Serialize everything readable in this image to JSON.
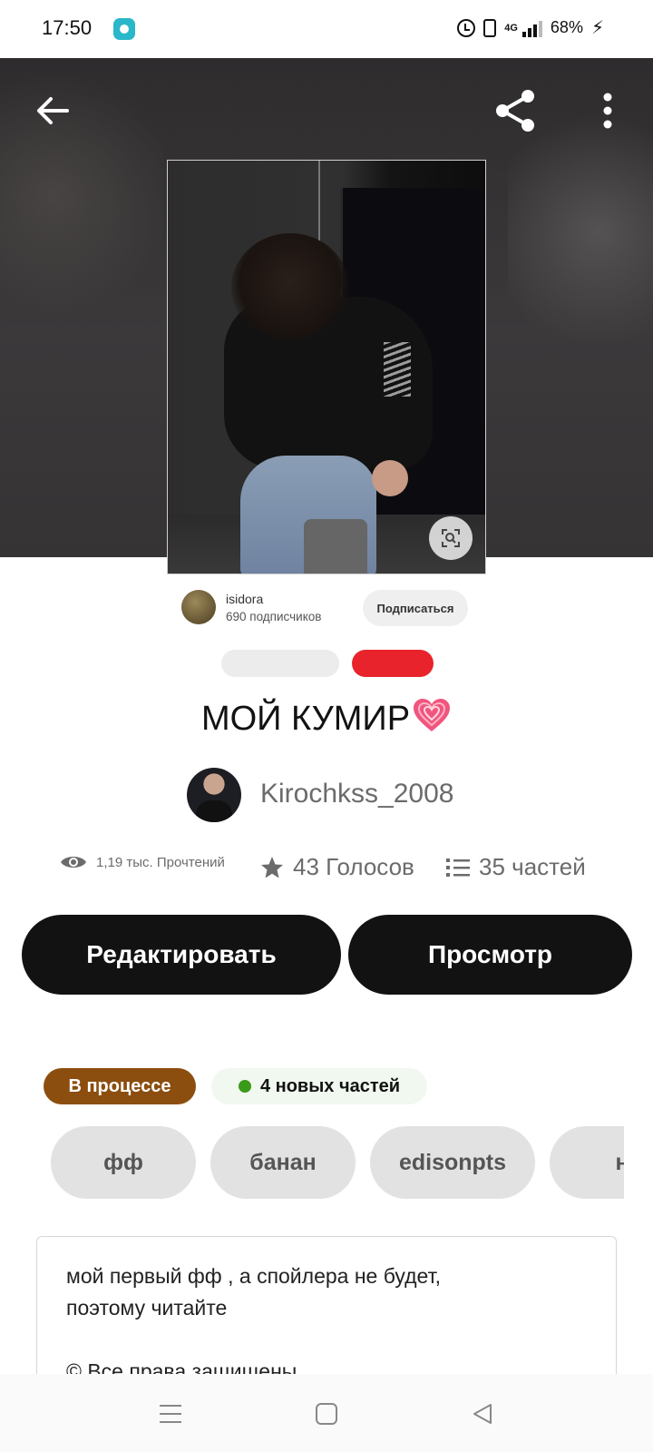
{
  "status_bar": {
    "time": "17:50",
    "network": "4G",
    "battery": "68%",
    "icons": [
      "app-icon",
      "alarm-icon",
      "vibrate-icon",
      "signal-icon",
      "battery-charging-icon"
    ]
  },
  "header": {
    "icons": [
      "back-arrow-icon",
      "share-icon",
      "more-vertical-icon"
    ]
  },
  "cover": {
    "embedded_profile": {
      "name": "isidora",
      "followers": "690 подписчиков",
      "subscribe_label": "Подписаться"
    },
    "lens_icon": "image-search-icon"
  },
  "story": {
    "title": "МОЙ КУМИР",
    "title_emoji": "growing-heart",
    "author": "Kirochkss_2008",
    "stats": {
      "reads": "1,19 тыс. Прочтений",
      "votes": "43 Голосов",
      "parts": "35 частей"
    },
    "buttons": {
      "edit": "Редактировать",
      "view": "Просмотр"
    },
    "status": {
      "label": "В процессе",
      "color": "#8b4e0f"
    },
    "new_parts": {
      "label": "4 новых частей",
      "dot_color": "#3a9a1a"
    },
    "tags": [
      "фф",
      "банан",
      "edisonpts",
      "н"
    ],
    "description": "мой первый фф , а спойлера не будет,\nпоэтому читайте\n\n© Все права защищены"
  },
  "nav_bar": {
    "icons": [
      "menu-icon",
      "home-square-icon",
      "back-triangle-icon"
    ]
  },
  "colors": {
    "primary_button": "#121212",
    "accent_red": "#e8232b",
    "heart_pink": "#f0557e"
  }
}
